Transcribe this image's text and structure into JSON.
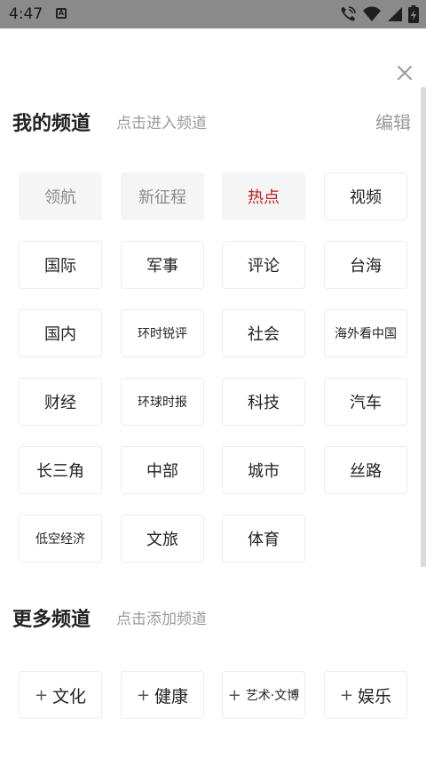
{
  "status_bar": {
    "time": "4:47"
  },
  "my_channels": {
    "title": "我的频道",
    "hint": "点击进入频道",
    "edit_label": "编辑",
    "items": [
      {
        "label": "领航",
        "state": "fixed"
      },
      {
        "label": "新征程",
        "state": "fixed"
      },
      {
        "label": "热点",
        "state": "active"
      },
      {
        "label": "视频",
        "state": "normal"
      },
      {
        "label": "国际",
        "state": "normal"
      },
      {
        "label": "军事",
        "state": "normal"
      },
      {
        "label": "评论",
        "state": "normal"
      },
      {
        "label": "台海",
        "state": "normal"
      },
      {
        "label": "国内",
        "state": "normal"
      },
      {
        "label": "环时锐评",
        "state": "small"
      },
      {
        "label": "社会",
        "state": "normal"
      },
      {
        "label": "海外看中国",
        "state": "small"
      },
      {
        "label": "财经",
        "state": "normal"
      },
      {
        "label": "环球时报",
        "state": "small"
      },
      {
        "label": "科技",
        "state": "normal"
      },
      {
        "label": "汽车",
        "state": "normal"
      },
      {
        "label": "长三角",
        "state": "normal"
      },
      {
        "label": "中部",
        "state": "normal"
      },
      {
        "label": "城市",
        "state": "normal"
      },
      {
        "label": "丝路",
        "state": "normal"
      },
      {
        "label": "低空经济",
        "state": "small"
      },
      {
        "label": "文旅",
        "state": "normal"
      },
      {
        "label": "体育",
        "state": "normal"
      }
    ]
  },
  "more_channels": {
    "title": "更多频道",
    "hint": "点击添加频道",
    "plus_symbol": "+",
    "items": [
      {
        "label": "文化",
        "state": "normal"
      },
      {
        "label": "健康",
        "state": "normal"
      },
      {
        "label": "艺术·文博",
        "state": "small"
      },
      {
        "label": "娱乐",
        "state": "normal"
      }
    ]
  },
  "colors": {
    "active": "#c21e1e",
    "muted": "#9a9a9a",
    "status_bar": "#8a8a8a"
  }
}
